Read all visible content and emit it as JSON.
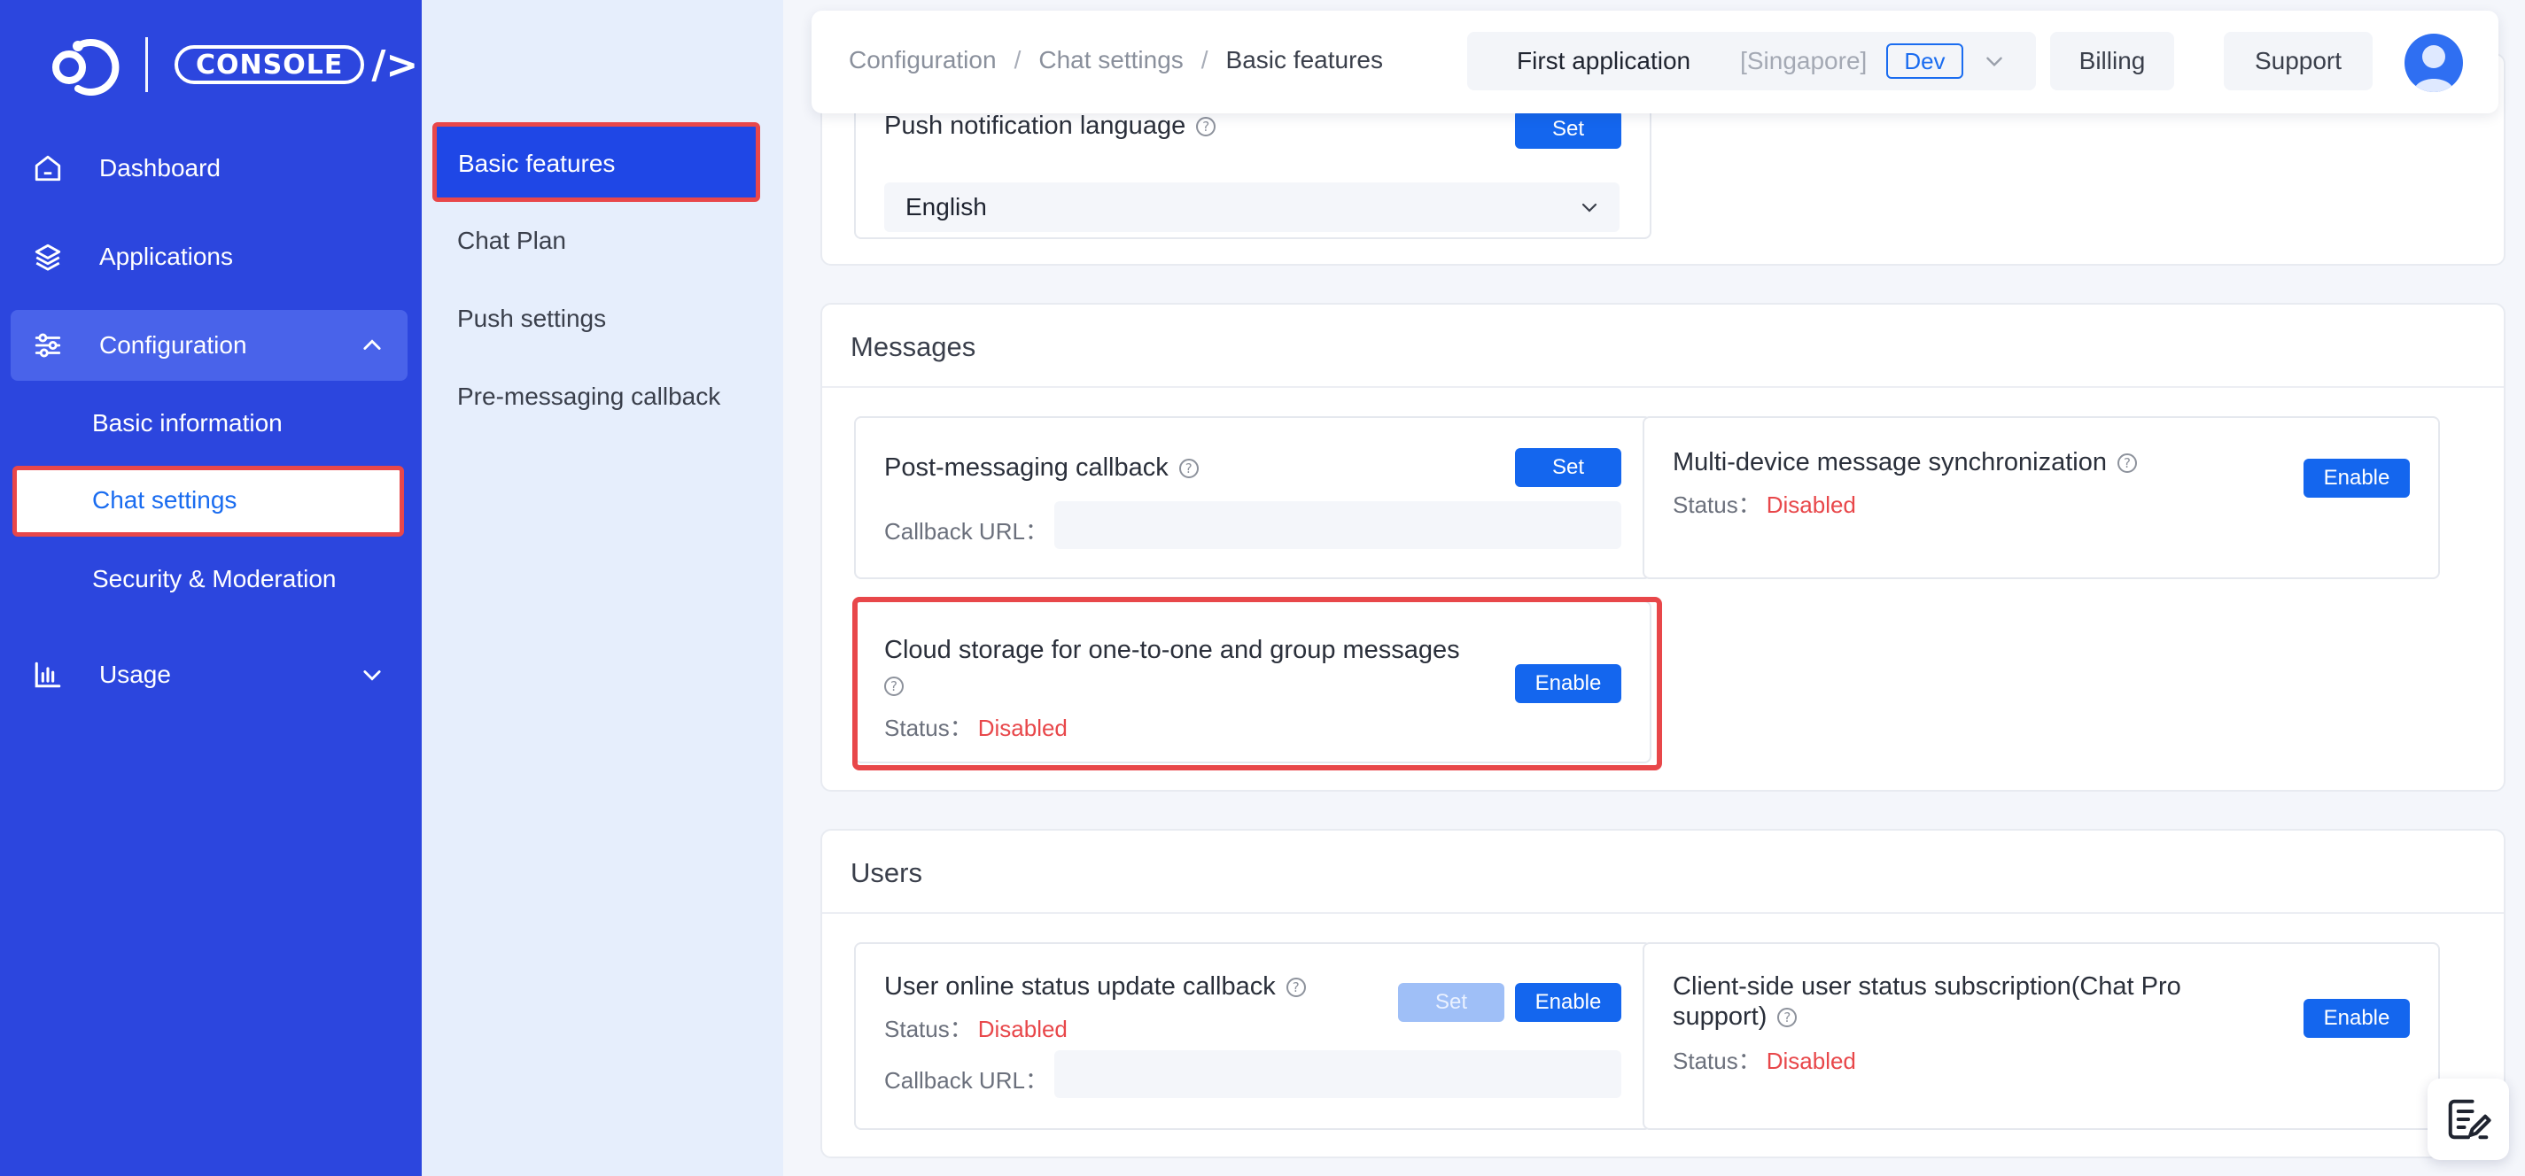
{
  "brand": {
    "badge": "CONSOLE",
    "slash": "/>"
  },
  "sidebar": {
    "items": [
      {
        "label": "Dashboard",
        "icon": "home-icon"
      },
      {
        "label": "Applications",
        "icon": "layers-icon"
      },
      {
        "label": "Configuration",
        "icon": "sliders-icon"
      },
      {
        "label": "Usage",
        "icon": "bar-chart-icon"
      }
    ],
    "config_sub": [
      "Basic information",
      "Chat settings",
      "Security & Moderation"
    ]
  },
  "subnav": {
    "items": [
      "Basic features",
      "Chat Plan",
      "Push settings",
      "Pre-messaging callback"
    ]
  },
  "header": {
    "breadcrumb": [
      "Configuration",
      "Chat settings",
      "Basic features"
    ],
    "separator": "/",
    "app_name": "First application",
    "region": "[Singapore]",
    "env": "Dev",
    "billing": "Billing",
    "support": "Support"
  },
  "push": {
    "title": "Push notification language",
    "set": "Set",
    "language": "English"
  },
  "messages": {
    "title": "Messages",
    "post_callback": {
      "title": "Post-messaging callback",
      "set": "Set",
      "url_label": "Callback URL："
    },
    "multi_device": {
      "title": "Multi-device message synchronization",
      "status_label": "Status：",
      "status": "Disabled",
      "button": "Enable"
    },
    "cloud_storage": {
      "title": "Cloud storage for one-to-one and group messages",
      "status_label": "Status：",
      "status": "Disabled",
      "button": "Enable"
    }
  },
  "users": {
    "title": "Users",
    "online_status": {
      "title": "User online status update callback",
      "status_label": "Status：",
      "status": "Disabled",
      "set": "Set",
      "button": "Enable",
      "url_label": "Callback URL："
    },
    "client_sub": {
      "title_line1": "Client-side user status subscription(Chat Pro",
      "title_line2": "support)",
      "status_label": "Status：",
      "status": "Disabled",
      "button": "Enable"
    }
  },
  "help_glyph": "?",
  "colors": {
    "sidebar": "#2c46de",
    "primary": "#1466ee",
    "danger": "#e8474a",
    "panel": "#e6eefc"
  }
}
